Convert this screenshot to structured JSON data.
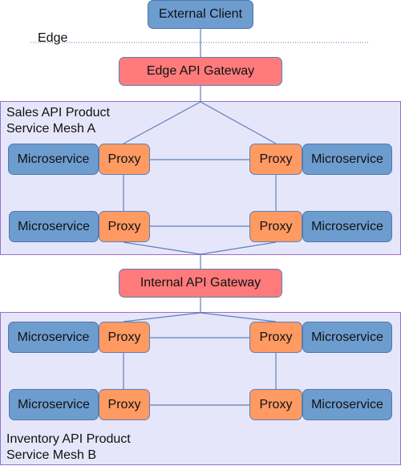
{
  "external_client": {
    "label": "External Client"
  },
  "edge_boundary": {
    "label": "Edge"
  },
  "edge_gateway": {
    "label": "Edge API Gateway"
  },
  "internal_gateway": {
    "label": "Internal API Gateway"
  },
  "mesh_a": {
    "title_line1": "Sales API Product",
    "title_line2": "Service Mesh A",
    "pairs": [
      {
        "microservice": "Microservice",
        "proxy": "Proxy"
      },
      {
        "microservice": "Microservice",
        "proxy": "Proxy"
      },
      {
        "microservice": "Microservice",
        "proxy": "Proxy"
      },
      {
        "microservice": "Microservice",
        "proxy": "Proxy"
      }
    ]
  },
  "mesh_b": {
    "title_line1": "Inventory API Product",
    "title_line2": "Service Mesh B",
    "pairs": [
      {
        "microservice": "Microservice",
        "proxy": "Proxy"
      },
      {
        "microservice": "Microservice",
        "proxy": "Proxy"
      },
      {
        "microservice": "Microservice",
        "proxy": "Proxy"
      },
      {
        "microservice": "Microservice",
        "proxy": "Proxy"
      }
    ]
  },
  "colors": {
    "client": "#6d9ccf",
    "gateway": "#ff7b7b",
    "microservice": "#6d9ccf",
    "proxy": "#ff9a63",
    "mesh_background": "#e6e6fa",
    "mesh_border": "#9a6fcc",
    "connector": "#5f80b8"
  }
}
